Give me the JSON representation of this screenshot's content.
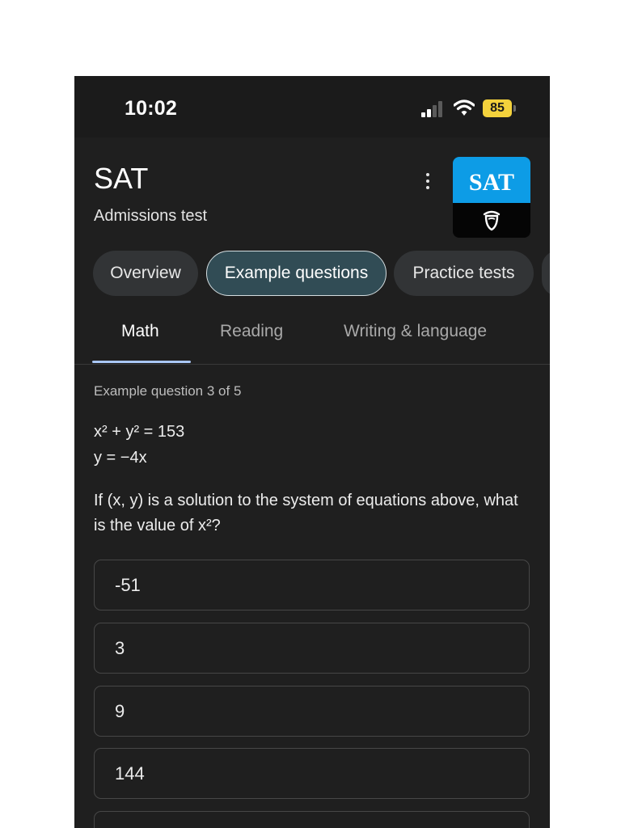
{
  "status": {
    "time": "10:02",
    "battery": "85"
  },
  "header": {
    "title": "SAT",
    "subtitle": "Admissions test",
    "logo_text": "SAT"
  },
  "chips": [
    {
      "label": "Overview",
      "selected": false
    },
    {
      "label": "Example questions",
      "selected": true
    },
    {
      "label": "Practice tests",
      "selected": false
    }
  ],
  "subtabs": [
    {
      "label": "Math",
      "active": true
    },
    {
      "label": "Reading",
      "active": false
    },
    {
      "label": "Writing & language",
      "active": false
    }
  ],
  "question": {
    "counter": "Example question 3 of 5",
    "equations": [
      "x² + y² = 153",
      "y = −4x"
    ],
    "prompt": "If (x, y) is a solution to the system of equations above, what is the value of x²?",
    "options": [
      "-51",
      "3",
      "9",
      "144"
    ]
  },
  "colors": {
    "background": "#1f1f1f",
    "selected_chip": "#314c55",
    "tab_underline": "#a9c7f6",
    "logo_blue": "#0d9ce6",
    "battery": "#f4d23c"
  },
  "icons": [
    "signal-icon",
    "wifi-icon",
    "more-vert-icon",
    "acorn-icon"
  ]
}
